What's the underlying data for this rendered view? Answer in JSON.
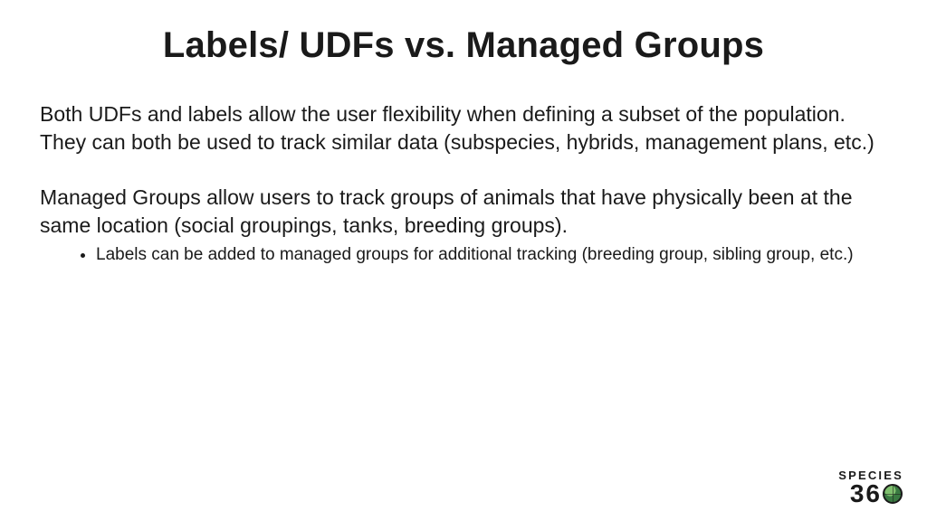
{
  "title": "Labels/ UDFs vs. Managed Groups",
  "paragraphs": {
    "p1": "Both UDFs and labels allow the user flexibility when defining a subset of the population. They can both be used to track similar data (subspecies, hybrids, management plans, etc.)",
    "p2": "Managed Groups allow users to track groups of animals that have physically been at the same location (social groupings, tanks, breeding groups)."
  },
  "bullets": {
    "b1": "Labels can be added to managed groups for additional tracking (breeding group, sibling group, etc.)"
  },
  "logo": {
    "top": "SPECIES",
    "d1": "3",
    "d2": "6"
  }
}
